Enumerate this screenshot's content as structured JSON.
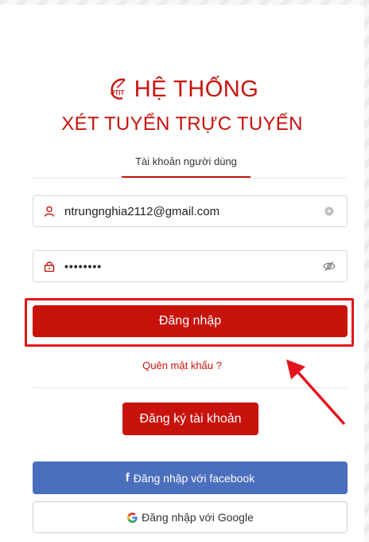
{
  "header": {
    "title_line1": "HỆ THỐNG",
    "title_line2": "XÉT TUYỂN TRỰC TUYẾN",
    "logo_text": "PTIT"
  },
  "tabs": {
    "active_label": "Tài khoản người dùng"
  },
  "form": {
    "email_value": "ntrungnghia2112@gmail.com",
    "password_value": "••••••••",
    "login_label": "Đăng nhập",
    "forgot_label": "Quên mật khẩu ?"
  },
  "register": {
    "label": "Đăng ký tài khoản"
  },
  "social": {
    "facebook_icon": "f",
    "facebook_label": "Đăng nhập với facebook",
    "google_label": "Đăng nhập với Google"
  },
  "colors": {
    "brand_red": "#c8120c",
    "highlight_red": "#e3141e",
    "facebook_blue": "#4a6fbd"
  }
}
